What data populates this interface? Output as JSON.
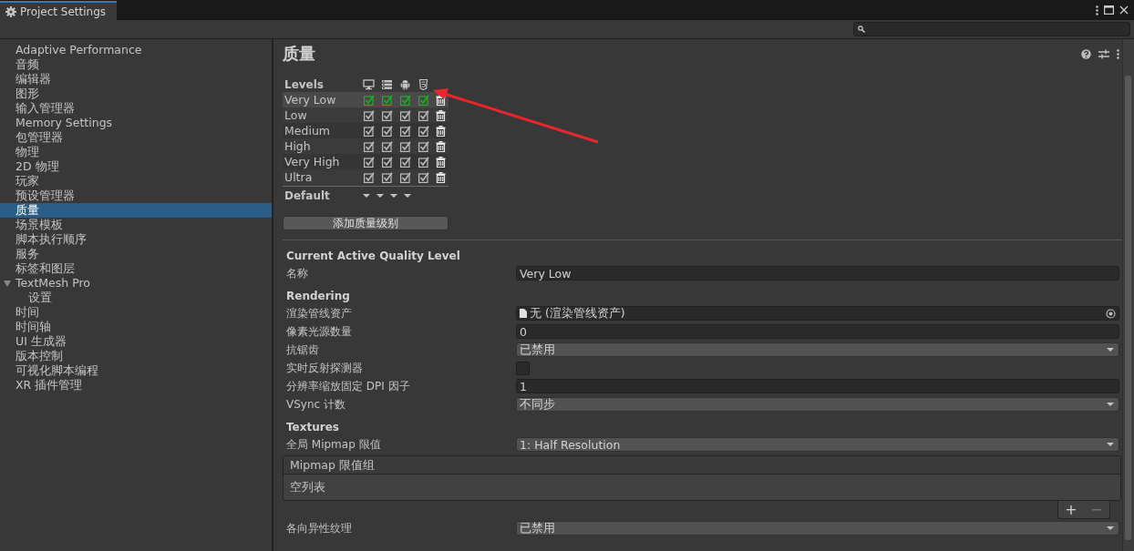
{
  "window": {
    "title": "Project Settings"
  },
  "sidebar": {
    "items": [
      {
        "label": "Adaptive Performance",
        "selected": false
      },
      {
        "label": "音频",
        "selected": false
      },
      {
        "label": "编辑器",
        "selected": false
      },
      {
        "label": "图形",
        "selected": false
      },
      {
        "label": "输入管理器",
        "selected": false
      },
      {
        "label": "Memory Settings",
        "selected": false
      },
      {
        "label": "包管理器",
        "selected": false
      },
      {
        "label": "物理",
        "selected": false
      },
      {
        "label": "2D 物理",
        "selected": false
      },
      {
        "label": "玩家",
        "selected": false
      },
      {
        "label": "预设管理器",
        "selected": false
      },
      {
        "label": "质量",
        "selected": true
      },
      {
        "label": "场景模板",
        "selected": false
      },
      {
        "label": "脚本执行顺序",
        "selected": false
      },
      {
        "label": "服务",
        "selected": false
      },
      {
        "label": "标签和图层",
        "selected": false
      },
      {
        "label": "TextMesh Pro",
        "selected": false,
        "expanded": true,
        "children": [
          {
            "label": "设置",
            "selected": false
          }
        ]
      },
      {
        "label": "时间",
        "selected": false
      },
      {
        "label": "时间轴",
        "selected": false
      },
      {
        "label": "UI 生成器",
        "selected": false
      },
      {
        "label": "版本控制",
        "selected": false
      },
      {
        "label": "可视化脚本编程",
        "selected": false
      },
      {
        "label": "XR 插件管理",
        "selected": false
      }
    ]
  },
  "page": {
    "title": "质量"
  },
  "levels": {
    "heading": "Levels",
    "rows": [
      {
        "name": "Very Low",
        "selected": true,
        "checks": [
          {
            "checked": true,
            "default": true
          },
          {
            "checked": true,
            "default": true
          },
          {
            "checked": true,
            "default": true
          },
          {
            "checked": true,
            "default": true
          }
        ]
      },
      {
        "name": "Low",
        "selected": false,
        "checks": [
          {
            "checked": true,
            "default": false
          },
          {
            "checked": true,
            "default": false
          },
          {
            "checked": true,
            "default": false
          },
          {
            "checked": true,
            "default": false
          }
        ]
      },
      {
        "name": "Medium",
        "selected": false,
        "checks": [
          {
            "checked": true,
            "default": false
          },
          {
            "checked": true,
            "default": false
          },
          {
            "checked": true,
            "default": false
          },
          {
            "checked": true,
            "default": false
          }
        ]
      },
      {
        "name": "High",
        "selected": false,
        "checks": [
          {
            "checked": true,
            "default": false
          },
          {
            "checked": true,
            "default": false
          },
          {
            "checked": true,
            "default": false
          },
          {
            "checked": true,
            "default": false
          }
        ]
      },
      {
        "name": "Very High",
        "selected": false,
        "checks": [
          {
            "checked": true,
            "default": false
          },
          {
            "checked": true,
            "default": false
          },
          {
            "checked": true,
            "default": false
          },
          {
            "checked": true,
            "default": false
          }
        ]
      },
      {
        "name": "Ultra",
        "selected": false,
        "checks": [
          {
            "checked": true,
            "default": false
          },
          {
            "checked": true,
            "default": false
          },
          {
            "checked": true,
            "default": false
          },
          {
            "checked": true,
            "default": false
          }
        ]
      }
    ],
    "default_label": "Default",
    "add_button": "添加质量级别"
  },
  "sections": [
    {
      "title": "Current Active Quality Level",
      "fields": [
        {
          "label": "名称",
          "kind": "text",
          "value": "Very Low"
        }
      ]
    },
    {
      "title": "Rendering",
      "fields": [
        {
          "label": "渲染管线资产",
          "kind": "object",
          "value": "无 (渲染管线资产)"
        },
        {
          "label": "像素光源数量",
          "kind": "text",
          "value": "0"
        },
        {
          "label": "抗锯齿",
          "kind": "dropdown",
          "value": "已禁用"
        },
        {
          "label": "实时反射探测器",
          "kind": "checkbox",
          "checked": false
        },
        {
          "label": "分辨率缩放固定 DPI 因子",
          "kind": "text",
          "value": "1"
        },
        {
          "label": "VSync 计数",
          "kind": "dropdown",
          "value": "不同步"
        }
      ]
    },
    {
      "title": "Textures",
      "fields": [
        {
          "label": "全局 Mipmap 限值",
          "kind": "dropdown",
          "value": "1: Half Resolution"
        },
        {
          "kind": "list",
          "header": "Mipmap 限值组",
          "empty_text": "空列表",
          "add": "+",
          "remove": "−"
        },
        {
          "label": "各向异性纹理",
          "kind": "dropdown",
          "value": "已禁用"
        }
      ]
    }
  ]
}
